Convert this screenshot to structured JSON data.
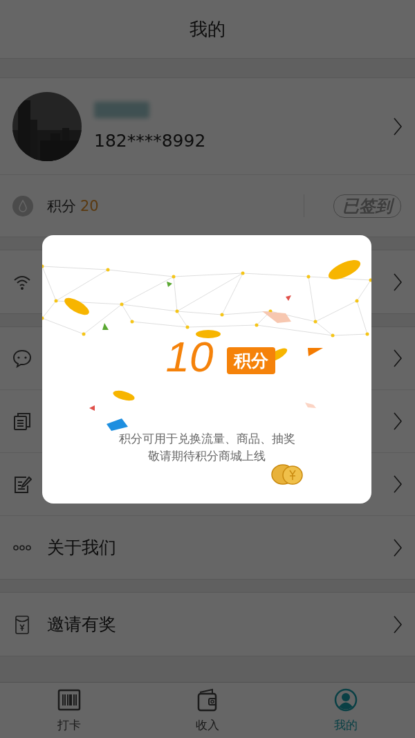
{
  "header": {
    "title": "我的"
  },
  "profile": {
    "name_blurred": true,
    "phone": "182****8992"
  },
  "points": {
    "label": "积分",
    "value": "20",
    "sign_in": "已签到"
  },
  "menu_sections": [
    [
      {
        "kind": "wifi"
      }
    ],
    [
      {
        "kind": "chat"
      },
      {
        "kind": "copy"
      },
      {
        "kind": "edit"
      },
      {
        "kind": "dots",
        "label": "关于我们"
      }
    ],
    [
      {
        "kind": "envelope",
        "label": "邀请有奖"
      }
    ]
  ],
  "dialog": {
    "amount": "10",
    "unit": "积分",
    "lines": [
      "积分可用于兑换流量、商品、抽奖",
      "敬请期待积分商城上线"
    ]
  },
  "tabs": [
    {
      "kind": "barcode",
      "label": "打卡",
      "selected": false
    },
    {
      "kind": "wallet",
      "label": "收入",
      "selected": false
    },
    {
      "kind": "person",
      "label": "我的",
      "selected": true
    }
  ]
}
